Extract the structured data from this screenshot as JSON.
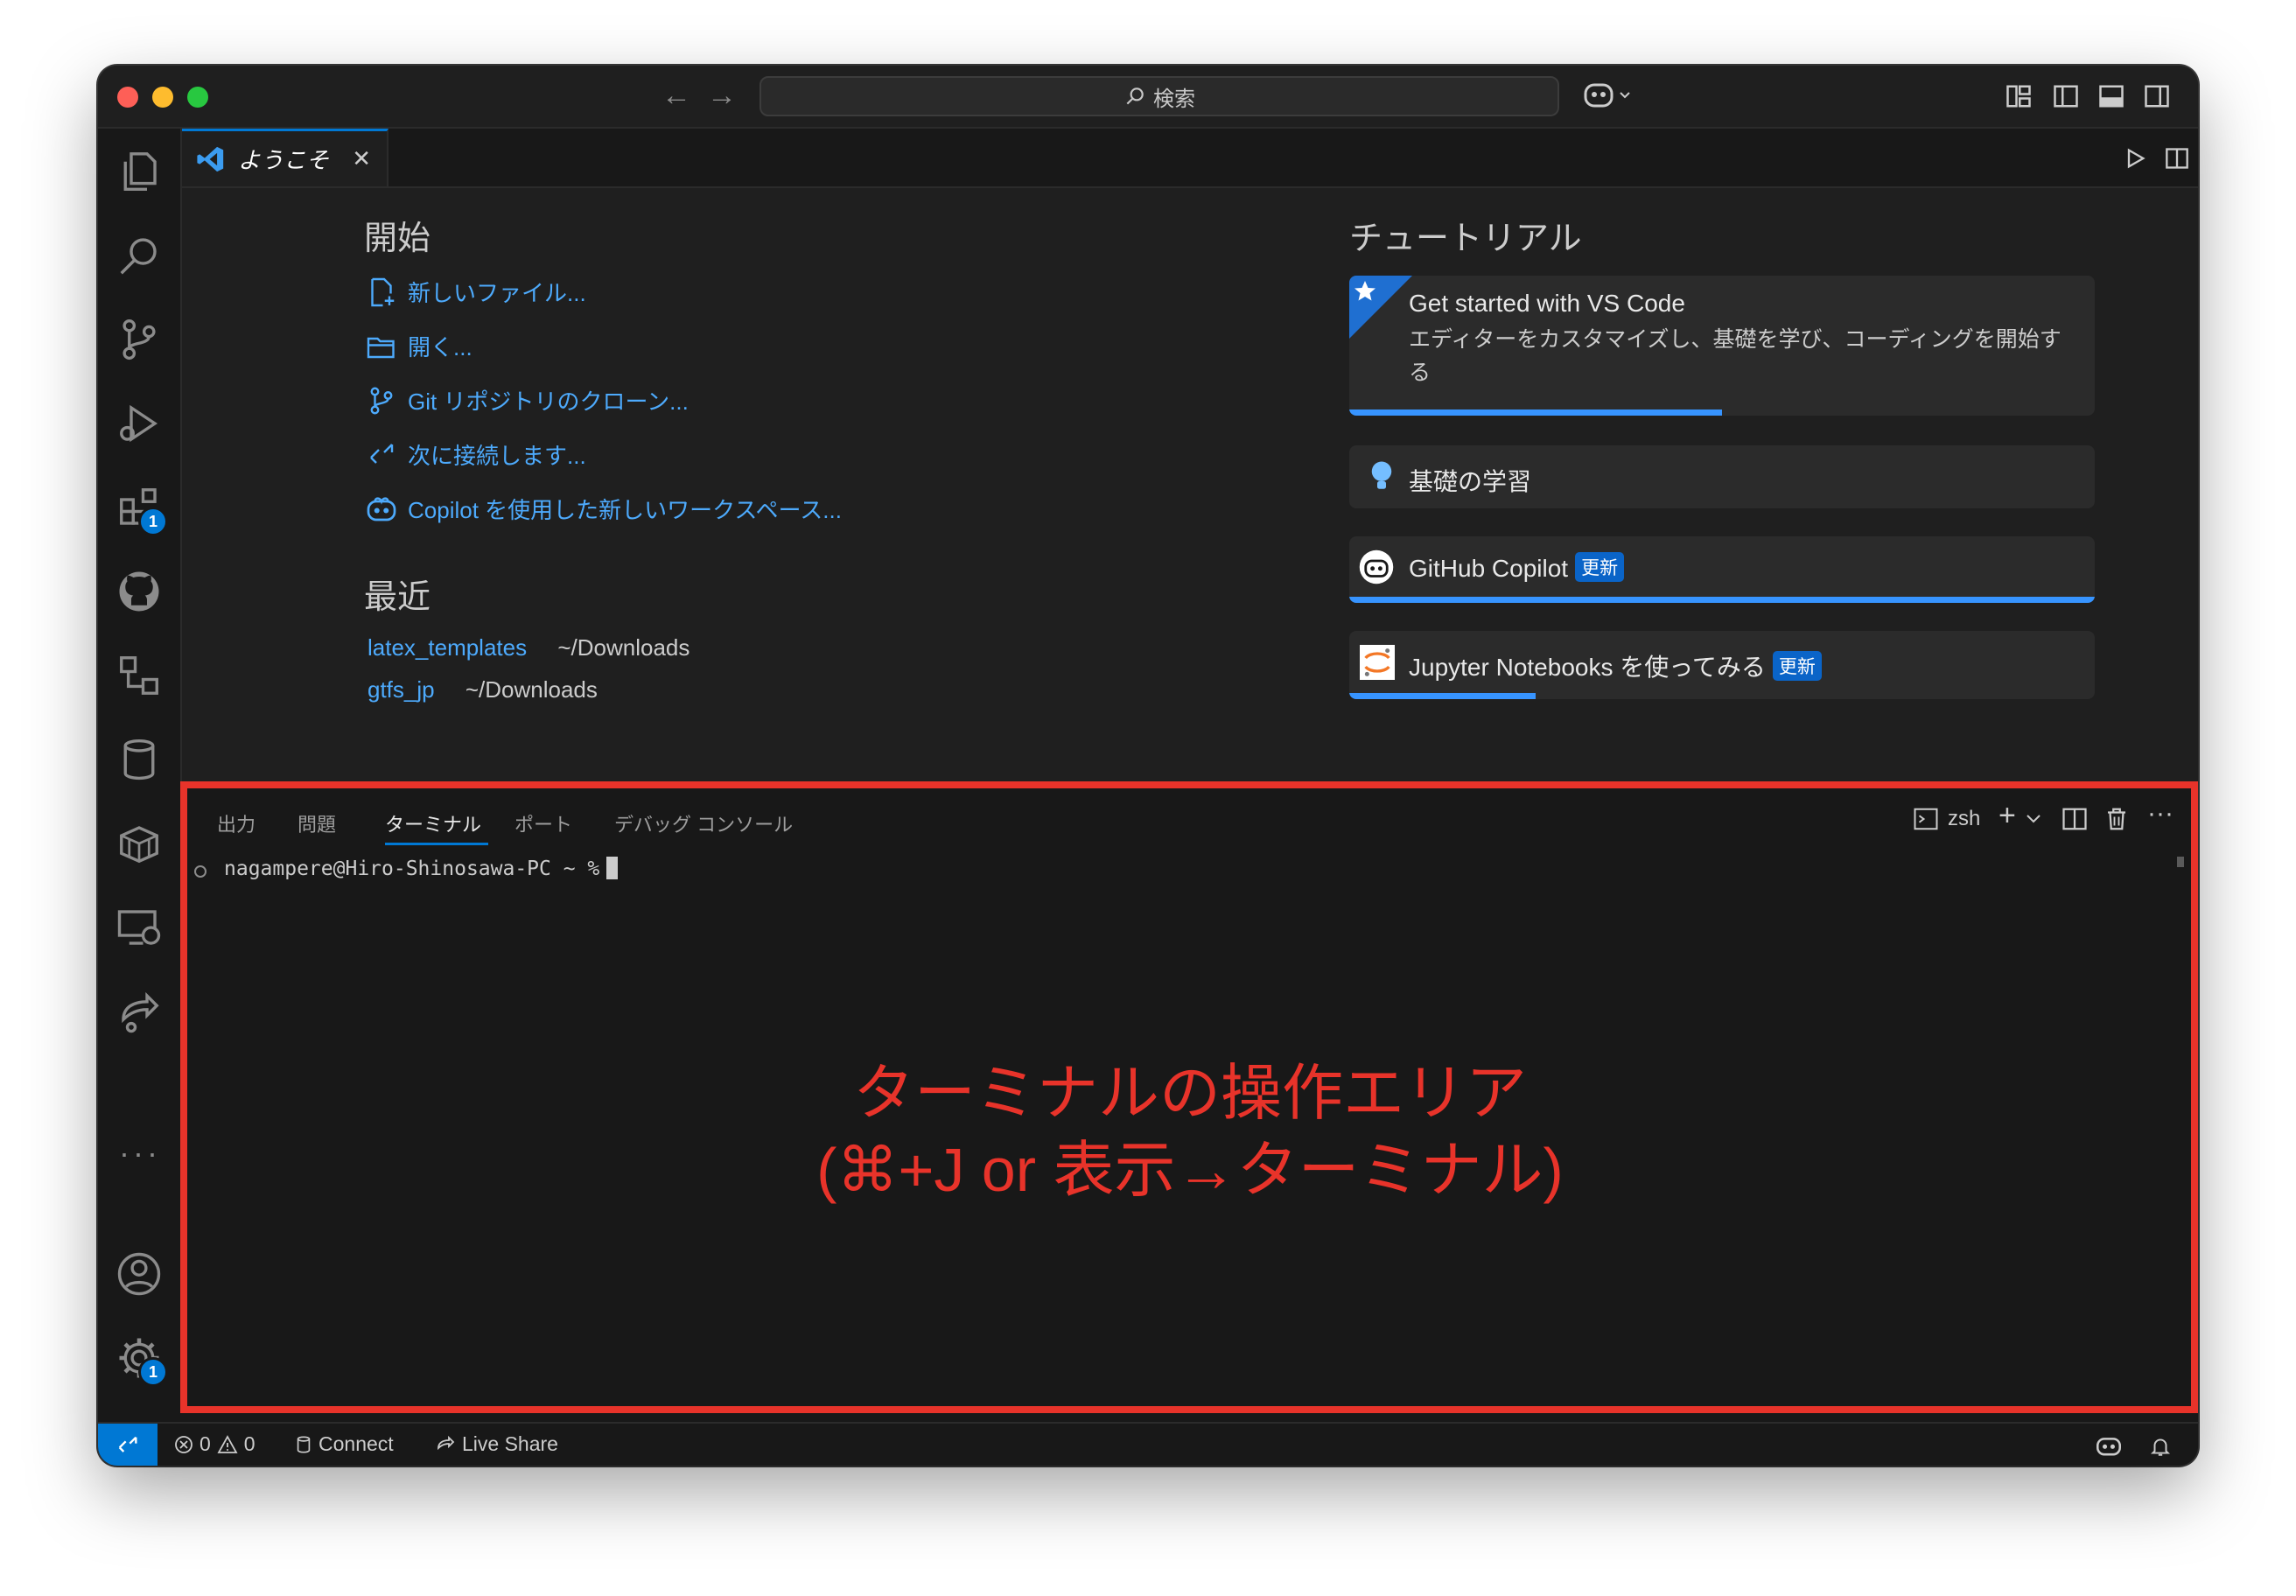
{
  "titlebar": {
    "search_label": "検索"
  },
  "activity_bar": {
    "extensions_badge": "1",
    "settings_badge": "1"
  },
  "editor": {
    "tab_label": "ようこそ"
  },
  "welcome": {
    "start_heading": "開始",
    "start_items": [
      {
        "label": "新しいファイル...",
        "icon": "new-file-icon"
      },
      {
        "label": "開く...",
        "icon": "folder-open-icon"
      },
      {
        "label": "Git リポジトリのクローン...",
        "icon": "source-control-icon"
      },
      {
        "label": "次に接続します...",
        "icon": "remote-icon"
      },
      {
        "label": "Copilot を使用した新しいワークスペース...",
        "icon": "copilot-icon"
      }
    ],
    "recent_heading": "最近",
    "recent": [
      {
        "name": "latex_templates",
        "path": "~/Downloads"
      },
      {
        "name": "gtfs_jp",
        "path": "~/Downloads"
      }
    ],
    "tutorial_heading": "チュートリアル",
    "tutorials": [
      {
        "title": "Get started with VS Code",
        "description": "エディターをカスタマイズし、基礎を学び、コーディングを開始する",
        "progress": 0.5
      },
      {
        "title": "基礎の学習"
      },
      {
        "title": "GitHub Copilot",
        "tag": "更新",
        "progress": 1.0
      },
      {
        "title": "Jupyter Notebooks を使ってみる",
        "tag": "更新",
        "progress": 0.25
      }
    ]
  },
  "panel": {
    "tabs": [
      "出力",
      "問題",
      "ターミナル",
      "ポート",
      "デバッグ コンソール"
    ],
    "active_tab": "ターミナル",
    "shell_label": "zsh",
    "prompt": "nagampere@Hiro-Shinosawa-PC ~ %"
  },
  "annotation": {
    "line1": "ターミナルの操作エリア",
    "line2": "(⌘+J or 表示→ターミナル)"
  },
  "statusbar": {
    "errors": "0",
    "warnings": "0",
    "connect_label": "Connect",
    "live_share_label": "Live Share"
  },
  "colors": {
    "accent": "#0078d4",
    "link": "#4daafc",
    "annotation_red": "#e8332a"
  }
}
